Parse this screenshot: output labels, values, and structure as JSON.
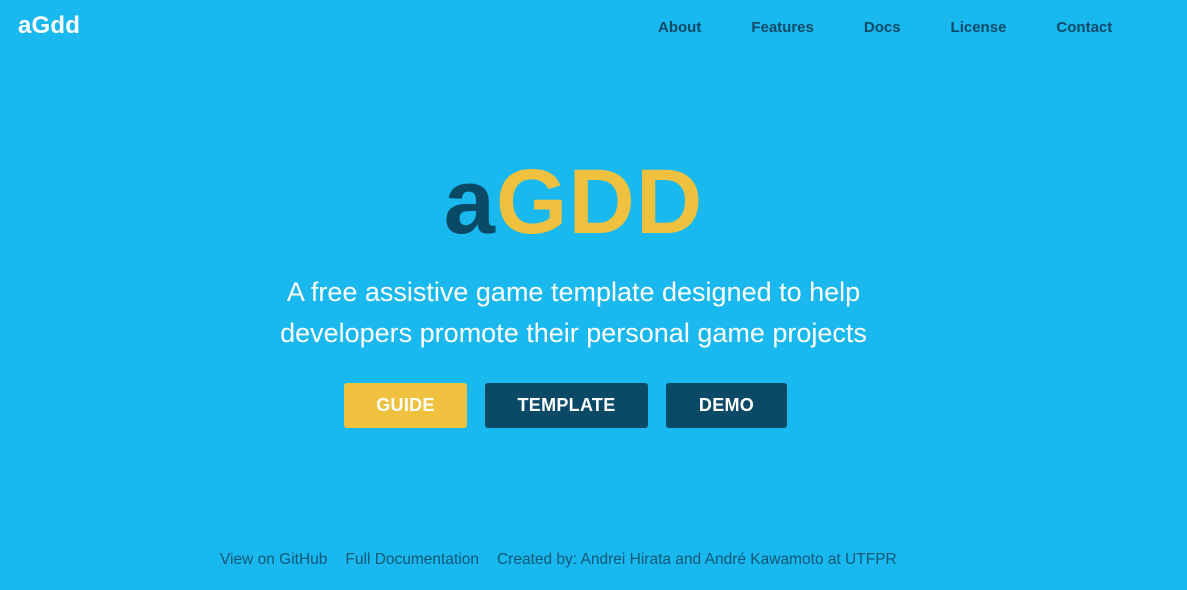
{
  "brand": "aGdd",
  "nav": {
    "items": [
      "About",
      "Features",
      "Docs",
      "License",
      "Contact"
    ]
  },
  "hero": {
    "title_a": "a",
    "title_gdd": "GDD",
    "tagline": "A free assistive game template designed to help developers promote their personal game projects",
    "buttons": {
      "guide": "GUIDE",
      "template": "TEMPLATE",
      "demo": "DEMO"
    }
  },
  "footer": {
    "github": "View on GitHub",
    "docs": "Full Documentation",
    "credits": "Created by: Andrei Hirata and André Kawamoto at UTFPR"
  },
  "colors": {
    "background": "#19b8ef",
    "accent_yellow": "#efc13e",
    "dark_blue": "#0b4a66",
    "text_white": "#ffffff"
  }
}
